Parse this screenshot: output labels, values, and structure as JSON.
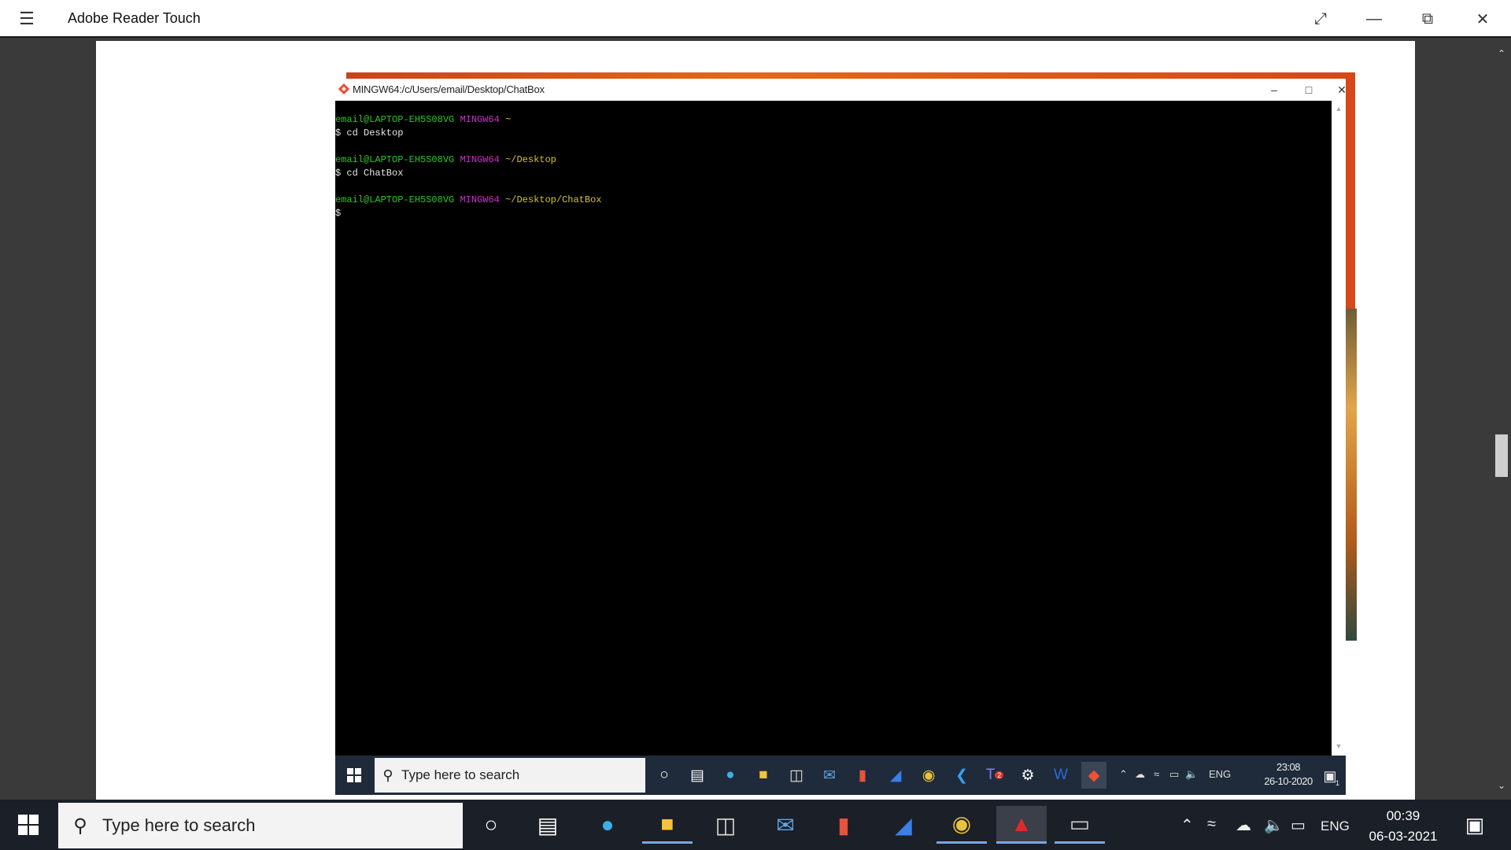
{
  "app": {
    "title": "Adobe Reader Touch",
    "menu_icon": "hamburger-icon",
    "window_buttons": [
      "fullscreen-icon",
      "minimize-icon",
      "restore-icon",
      "close-icon"
    ]
  },
  "git_window": {
    "title": "MINGW64:/c/Users/email/Desktop/ChatBox",
    "terminal": [
      {
        "user": "email@LAPTOP-EH5S08VG",
        "shell": "MINGW64",
        "path": "~"
      },
      {
        "command": "$ cd Desktop"
      },
      {
        "blank": true
      },
      {
        "user": "email@LAPTOP-EH5S08VG",
        "shell": "MINGW64",
        "path": "~/Desktop"
      },
      {
        "command": "$ cd ChatBox"
      },
      {
        "blank": true
      },
      {
        "user": "email@LAPTOP-EH5S08VG",
        "shell": "MINGW64",
        "path": "~/Desktop/ChatBox"
      },
      {
        "command": "$"
      }
    ]
  },
  "inner_taskbar": {
    "search_placeholder": "Type here to search",
    "language": "ENG",
    "time": "23:08",
    "date": "26-10-2020",
    "notification_count": "1",
    "teams_badge": "2"
  },
  "taskbar": {
    "search_placeholder": "Type here to search",
    "language": "ENG",
    "time": "00:39",
    "date": "06-03-2021"
  },
  "colors": {
    "prompt_user": "#2bc52b",
    "prompt_shell": "#c930c9",
    "prompt_path": "#d0c530",
    "taskbar_bg": "#1b1f27"
  }
}
